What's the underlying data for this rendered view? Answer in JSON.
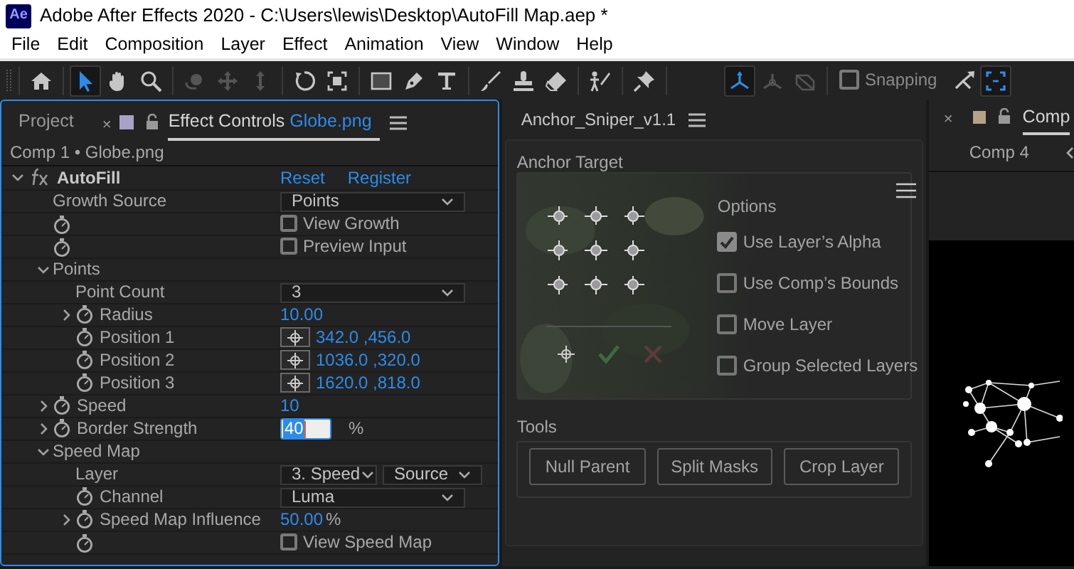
{
  "window": {
    "app_icon": "Ae",
    "title": "Adobe After Effects 2020 - C:\\Users\\lewis\\Desktop\\AutoFill Map.aep *"
  },
  "menu": [
    "File",
    "Edit",
    "Composition",
    "Layer",
    "Effect",
    "Animation",
    "View",
    "Window",
    "Help"
  ],
  "toolbar": {
    "tool_groups": [
      [
        {
          "kind": "home",
          "selected": false,
          "disabled": false
        }
      ],
      [
        {
          "kind": "select",
          "selected": true,
          "disabled": false
        },
        {
          "kind": "hand",
          "selected": false,
          "disabled": false
        },
        {
          "kind": "zoom",
          "selected": false,
          "disabled": false
        }
      ],
      [
        {
          "kind": "orbit",
          "selected": false,
          "disabled": true
        },
        {
          "kind": "pan",
          "selected": false,
          "disabled": true
        },
        {
          "kind": "dolly",
          "selected": false,
          "disabled": true
        }
      ],
      [
        {
          "kind": "rotate",
          "selected": false,
          "disabled": false
        },
        {
          "kind": "region",
          "selected": false,
          "disabled": false
        }
      ],
      [
        {
          "kind": "rectangle",
          "selected": false,
          "disabled": false
        },
        {
          "kind": "pen",
          "selected": false,
          "disabled": false
        },
        {
          "kind": "type",
          "selected": false,
          "disabled": false
        }
      ],
      [
        {
          "kind": "brush",
          "selected": false,
          "disabled": false
        },
        {
          "kind": "stamp",
          "selected": false,
          "disabled": false
        },
        {
          "kind": "eraser",
          "selected": false,
          "disabled": false
        }
      ],
      [
        {
          "kind": "roto",
          "selected": false,
          "disabled": false
        }
      ],
      [
        {
          "kind": "pin",
          "selected": false,
          "disabled": false
        }
      ]
    ],
    "axis_modes": [
      {
        "kind": "local",
        "selected": true,
        "disabled": false
      },
      {
        "kind": "world",
        "selected": false,
        "disabled": true
      },
      {
        "kind": "view",
        "selected": false,
        "disabled": true
      }
    ],
    "snapping": {
      "label": "Snapping",
      "checked": false
    },
    "snap_tools": [
      {
        "kind": "snap_arrow",
        "selected": false,
        "disabled": false
      },
      {
        "kind": "snap_box",
        "selected": true,
        "disabled": false
      }
    ]
  },
  "effect_panel": {
    "tabs": [
      {
        "label": "Project",
        "selected": false
      },
      {
        "label": "Effect Controls",
        "layer": "Globe.png",
        "close": "×",
        "selected": true
      }
    ],
    "breadcrumb": "Comp 1 • Globe.png",
    "effect": {
      "name": "AutoFill",
      "expanded": true,
      "links": [
        "Reset",
        "Register"
      ],
      "properties": [
        {
          "name": "Growth Source",
          "kind": "dropdown",
          "stopwatch": false,
          "value": "Points"
        },
        {
          "kind": "checkbox",
          "stopwatch": true,
          "label": "View Growth",
          "checked": false
        },
        {
          "kind": "checkbox",
          "stopwatch": true,
          "label": "Preview Input",
          "checked": false
        },
        {
          "name": "Points",
          "kind": "group",
          "stopwatch": false,
          "expanded": true,
          "children": [
            {
              "name": "Point Count",
              "kind": "dropdown",
              "stopwatch": false,
              "value": "3"
            },
            {
              "name": "Radius",
              "kind": "number",
              "stopwatch": true,
              "expanded": false,
              "value": "10.00"
            },
            {
              "name": "Position 1",
              "kind": "point",
              "stopwatch": true,
              "value": "342.0 ,456.0"
            },
            {
              "name": "Position 2",
              "kind": "point",
              "stopwatch": true,
              "value": "1036.0 ,320.0"
            },
            {
              "name": "Position 3",
              "kind": "point",
              "stopwatch": true,
              "value": "1620.0 ,818.0"
            }
          ]
        },
        {
          "name": "Speed",
          "kind": "number",
          "stopwatch": true,
          "expanded": false,
          "value": "10"
        },
        {
          "name": "Border Strength",
          "kind": "editing",
          "stopwatch": true,
          "expanded": false,
          "value": "40",
          "unit": "%"
        },
        {
          "name": "Speed Map",
          "kind": "group",
          "stopwatch": false,
          "expanded": true,
          "children": [
            {
              "name": "Layer",
              "kind": "layer_picker",
              "stopwatch": false,
              "value": "3. Speed",
              "source": "Source"
            },
            {
              "name": "Channel",
              "kind": "dropdown",
              "stopwatch": true,
              "value": "Luma"
            },
            {
              "name": "Speed Map Influence",
              "kind": "number",
              "stopwatch": true,
              "expanded": false,
              "value": "50.00",
              "unit": "%"
            },
            {
              "kind": "checkbox",
              "stopwatch": true,
              "label": "View Speed Map",
              "checked": false
            }
          ]
        }
      ]
    }
  },
  "anchor_panel": {
    "title": "Anchor_Sniper_v1.1",
    "anchor_target": {
      "label": "Anchor Target",
      "anchors": [
        {
          "kind": "top_left"
        },
        {
          "kind": "top"
        },
        {
          "kind": "top_right"
        },
        {
          "kind": "left"
        },
        {
          "kind": "center"
        },
        {
          "kind": "right"
        },
        {
          "kind": "bottom_left"
        },
        {
          "kind": "bottom"
        },
        {
          "kind": "bottom_right"
        }
      ],
      "actions": [
        {
          "kind": "target"
        },
        {
          "kind": "apply"
        },
        {
          "kind": "cancel"
        }
      ]
    },
    "options": {
      "title": "Options",
      "items": [
        {
          "label": "Use Layer’s Alpha",
          "checked": true
        },
        {
          "label": "Use Comp’s Bounds",
          "checked": false
        },
        {
          "label": "Move Layer",
          "checked": false
        },
        {
          "label": "Group Selected Layers",
          "checked": false
        }
      ]
    },
    "tools": {
      "label": "Tools",
      "buttons": [
        "Null Parent",
        "Split Masks",
        "Crop Layer"
      ]
    }
  },
  "comp_panel": {
    "tab": {
      "label": "Comp",
      "close": "×",
      "selected": true
    },
    "breadcrumb": "Comp 4"
  }
}
